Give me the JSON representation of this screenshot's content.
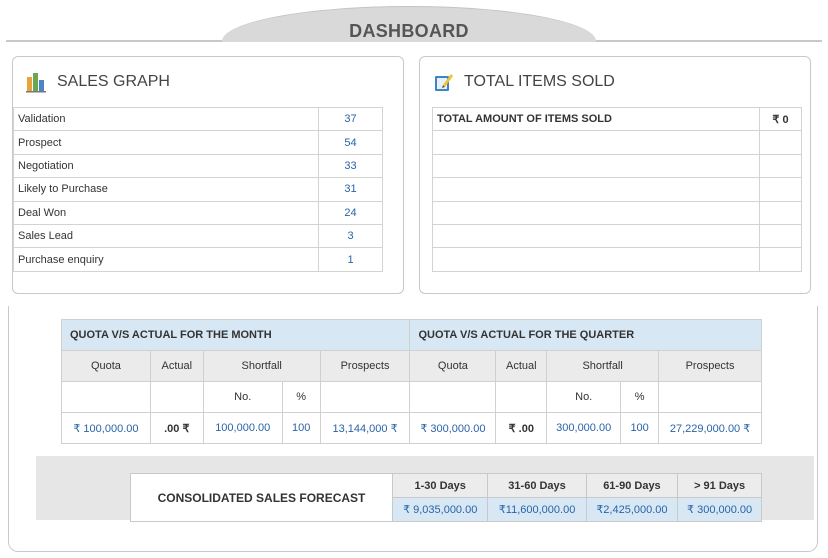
{
  "header": {
    "title": "DASHBOARD"
  },
  "sales_graph": {
    "title": "SALES GRAPH",
    "rows": [
      {
        "label": "Validation",
        "value": "37"
      },
      {
        "label": "Prospect",
        "value": "54"
      },
      {
        "label": "Negotiation",
        "value": "33"
      },
      {
        "label": "Likely to Purchase",
        "value": "31"
      },
      {
        "label": "Deal Won",
        "value": "24"
      },
      {
        "label": "Sales Lead",
        "value": "3"
      },
      {
        "label": "Purchase enquiry",
        "value": "1"
      }
    ]
  },
  "items_sold": {
    "title": "TOTAL ITEMS SOLD",
    "total_label": "TOTAL AMOUNT OF ITEMS SOLD",
    "total_value": "₹ 0"
  },
  "quota_month": {
    "title": "QUOTA V/S ACTUAL FOR THE MONTH",
    "headers": {
      "quota": "Quota",
      "actual": "Actual",
      "shortfall": "Shortfall",
      "prospects": "Prospects",
      "no": "No.",
      "pct": "%"
    },
    "values": {
      "quota": "₹ 100,000.00",
      "actual": ".00 ₹",
      "no": "100,000.00",
      "pct": "100",
      "prospects": "13,144,000 ₹"
    }
  },
  "quota_quarter": {
    "title": "QUOTA V/S ACTUAL FOR THE QUARTER",
    "headers": {
      "quota": "Quota",
      "actual": "Actual",
      "shortfall": "Shortfall",
      "prospects": "Prospects",
      "no": "No.",
      "pct": "%"
    },
    "values": {
      "quota": "₹ 300,000.00",
      "actual": "₹ .00",
      "no": "300,000.00",
      "pct": "100",
      "prospects": "27,229,000.00 ₹"
    }
  },
  "forecast": {
    "title": "CONSOLIDATED SALES FORECAST",
    "periods": [
      {
        "label": "1-30 Days",
        "value": "₹ 9,035,000.00"
      },
      {
        "label": "31-60 Days",
        "value": "₹11,600,000.00"
      },
      {
        "label": "61-90 Days",
        "value": "₹2,425,000.00"
      },
      {
        "label": "> 91 Days",
        "value": "₹ 300,000.00"
      }
    ]
  },
  "colors": {
    "accent_blue": "#2a63a8",
    "header_blue": "#d7e8f4"
  },
  "icons": {
    "sales_graph": "bar-chart-icon",
    "items_sold": "notepad-pencil-icon"
  }
}
